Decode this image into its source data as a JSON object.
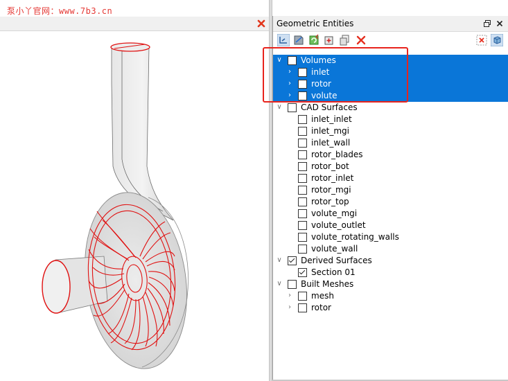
{
  "watermark": "泵小丫官网：www.7b3.cn",
  "panel": {
    "title": "Geometric Entities"
  },
  "toolbar": [
    "view-icon",
    "filter-icon",
    "refresh-icon",
    "add-icon",
    "copy-icon",
    "delete-icon",
    "clear-icon",
    "display-icon"
  ],
  "tree": {
    "volumes": {
      "label": "Volumes",
      "checked": false,
      "expanded": true
    },
    "volume_items": [
      {
        "label": "inlet",
        "checked": false
      },
      {
        "label": "rotor",
        "checked": false
      },
      {
        "label": "volute",
        "checked": false
      }
    ],
    "cad_surfaces": {
      "label": "CAD Surfaces",
      "checked": false,
      "expanded": true
    },
    "surface_items": [
      {
        "label": "inlet_inlet",
        "checked": false
      },
      {
        "label": "inlet_mgi",
        "checked": false
      },
      {
        "label": "inlet_wall",
        "checked": false
      },
      {
        "label": "rotor_blades",
        "checked": false
      },
      {
        "label": "rotor_bot",
        "checked": false
      },
      {
        "label": "rotor_inlet",
        "checked": false
      },
      {
        "label": "rotor_mgi",
        "checked": false
      },
      {
        "label": "rotor_top",
        "checked": false
      },
      {
        "label": "volute_mgi",
        "checked": false
      },
      {
        "label": "volute_outlet",
        "checked": false
      },
      {
        "label": "volute_rotating_walls",
        "checked": false
      },
      {
        "label": "volute_wall",
        "checked": false
      }
    ],
    "derived_surfaces": {
      "label": "Derived Surfaces",
      "checked": true,
      "expanded": true
    },
    "derived_items": [
      {
        "label": "Section 01",
        "checked": true
      }
    ],
    "built_meshes": {
      "label": "Built Meshes",
      "checked": false,
      "expanded": true
    },
    "mesh_items": [
      {
        "label": "mesh",
        "checked": false
      },
      {
        "label": "rotor",
        "checked": false
      }
    ]
  },
  "colors": {
    "selection": "#0a76d8",
    "highlight_box": "#e8231c",
    "edges": "#e01010",
    "watermark": "#e53935"
  }
}
